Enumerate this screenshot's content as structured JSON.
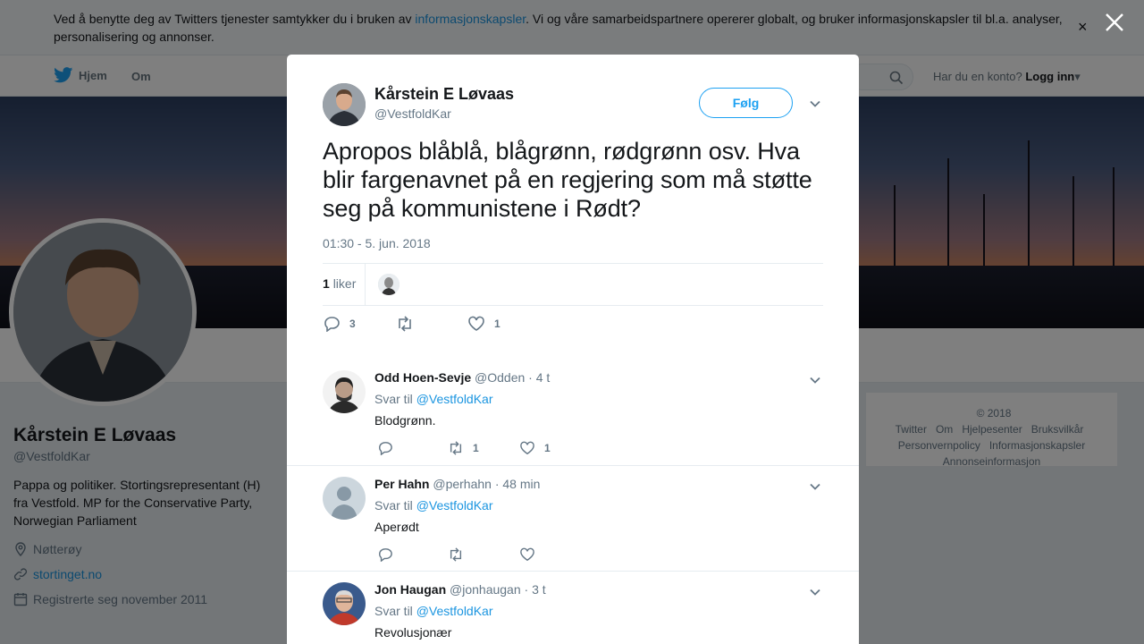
{
  "cookie_banner": {
    "text_before": "Ved å benytte deg av Twitters tjenester samtykker du i bruken av ",
    "link": "informasjonskapsler",
    "text_after": ". Vi og våre samarbeidspartnere opererer globalt, og bruker informasjonskapsler til bl.a. analyser, personalisering og annonser.",
    "close": "×"
  },
  "nav": {
    "home": "Hjem",
    "about": "Om",
    "login_prompt": "Har du en konto?",
    "login": "Logg inn",
    "login_caret": "▾"
  },
  "profile": {
    "name": "Kårstein E Løvaas",
    "handle": "@VestfoldKar",
    "bio": "Pappa og politiker. Stortingsrepresentant (H) fra Vestfold. MP for the Conservative Party, Norwegian Parliament",
    "location": "Nøtterøy",
    "url": "stortinget.no",
    "joined": "Registrerte seg november 2011"
  },
  "footer": {
    "links": [
      "© 2018 Twitter",
      "Om",
      "Hjelpesenter",
      "Bruksvilkår",
      "Personvernpolicy",
      "Informasjonskapsler",
      "Annonseinformasjon"
    ]
  },
  "tweet": {
    "author_name": "Kårstein E Løvaas",
    "author_handle": "@VestfoldKar",
    "follow_label": "Følg",
    "text": "Apropos blåblå, blågrønn, rødgrønn osv. Hva blir fargenavnet på en regjering som må støtte seg på kommunistene i Rødt?",
    "time": "01:30 - 5. jun. 2018",
    "likes_count": "1",
    "likes_label": "liker",
    "reply_count": "3",
    "retweet_count": "",
    "like_count": "1"
  },
  "replies": [
    {
      "name": "Odd Hoen-Sevje",
      "handle": "@Odden",
      "time": "· 4 t",
      "reply_to_prefix": "Svar til",
      "reply_to": "@VestfoldKar",
      "text": "Blodgrønn.",
      "reply_count": "",
      "retweet_count": "1",
      "like_count": "1"
    },
    {
      "name": "Per Hahn",
      "handle": "@perhahn",
      "time": "· 48 min",
      "reply_to_prefix": "Svar til",
      "reply_to": "@VestfoldKar",
      "text": "Aperødt",
      "reply_count": "",
      "retweet_count": "",
      "like_count": ""
    },
    {
      "name": "Jon Haugan",
      "handle": "@jonhaugan",
      "time": "· 3 t",
      "reply_to_prefix": "Svar til",
      "reply_to": "@VestfoldKar",
      "text": "Revolusjonær"
    }
  ],
  "colors": {
    "accent": "#1da1f2",
    "link": "#1b95e0",
    "secondary_text": "#657786"
  }
}
